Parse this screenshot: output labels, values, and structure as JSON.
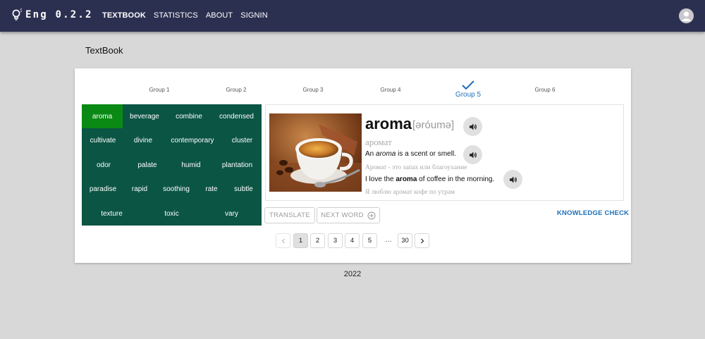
{
  "app": {
    "name": "Eng 0.2.2"
  },
  "nav": {
    "items": [
      "TEXTBOOK",
      "STATISTICS",
      "ABOUT",
      "SIGNIN"
    ],
    "active": "TEXTBOOK"
  },
  "page": {
    "title": "TextBook"
  },
  "groups": [
    "Group 1",
    "Group 2",
    "Group 3",
    "Group 4",
    "Group 5",
    "Group 6"
  ],
  "active_group": "Group 5",
  "words": [
    [
      "aroma",
      "beverage",
      "combine",
      "condensed"
    ],
    [
      "cultivate",
      "divine",
      "contemporary",
      "cluster"
    ],
    [
      "odor",
      "palate",
      "humid",
      "plantation"
    ],
    [
      "paradise",
      "rapid",
      "soothing",
      "rate",
      "subtle"
    ],
    [
      "texture",
      "toxic",
      "vary"
    ]
  ],
  "active_word": "aroma",
  "word_card": {
    "word": "aroma",
    "transcription": "[əróumə]",
    "translation": "аромат",
    "meaning_pre": "An ",
    "meaning_word": "aroma",
    "meaning_post": " is a scent or smell.",
    "meaning_ru": "Аромат - это запах или благоухание",
    "example_pre": "I love the ",
    "example_word": "aroma",
    "example_post": " of coffee in the morning.",
    "example_ru": "Я люблю аромат кофе по утрам"
  },
  "actions": {
    "translate": "TRANSLATE",
    "next_word": "NEXT WORD",
    "knowledge_check": "KNOWLEDGE CHECK"
  },
  "pagination": {
    "pages": [
      "1",
      "2",
      "3",
      "4",
      "5"
    ],
    "ellipsis": "…",
    "last": "30",
    "current": "1"
  },
  "footer": {
    "year": "2022"
  },
  "colors": {
    "header": "#2c3050",
    "grid": "#0b5544",
    "active_word": "#0a8a14",
    "accent": "#1e6fb8"
  },
  "icons": [
    "bulb-icon",
    "avatar-icon",
    "checkmark-icon",
    "speaker-icon",
    "add-circle-icon",
    "chevron-left-icon",
    "chevron-right-icon"
  ]
}
